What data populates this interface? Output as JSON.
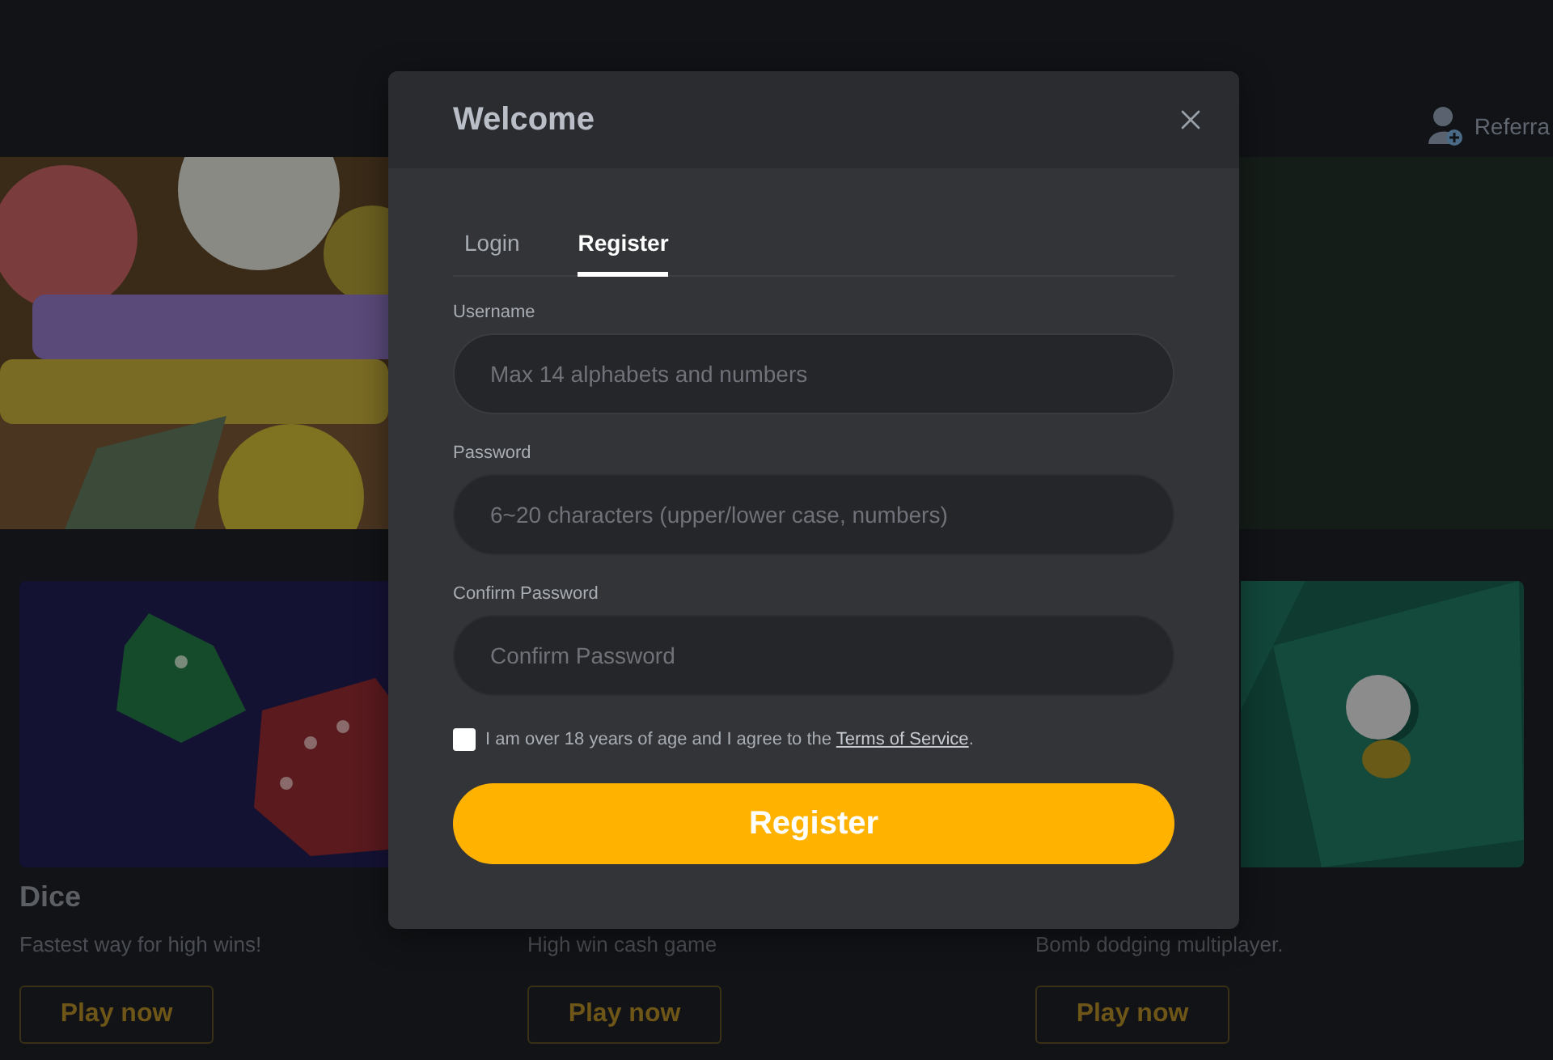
{
  "header": {
    "referral_label": "Referra"
  },
  "games": [
    {
      "kind": "dice",
      "title": "Dice",
      "description": "Fastest way for high wins!",
      "button": "Play now"
    },
    {
      "kind": "hidden",
      "description": "High win cash game",
      "button": "Play now"
    },
    {
      "kind": "board",
      "description": "Bomb dodging multiplayer.",
      "button": "Play now"
    }
  ],
  "modal": {
    "title": "Welcome",
    "tabs": [
      {
        "label": "Login",
        "selected": false
      },
      {
        "label": "Register",
        "selected": true
      }
    ],
    "fields": [
      {
        "label": "Username",
        "placeholder": "Max 14 alphabets and numbers",
        "focused": true
      },
      {
        "label": "Password",
        "placeholder": "6~20 characters (upper/lower case, numbers)",
        "focused": false
      },
      {
        "label": "Confirm Password",
        "placeholder": "Confirm Password",
        "focused": false
      }
    ],
    "agreement": {
      "checked": false,
      "text": "I am over 18 years of age and I agree to the ",
      "link": "Terms of Service",
      "end": "."
    },
    "submit": "Register"
  }
}
